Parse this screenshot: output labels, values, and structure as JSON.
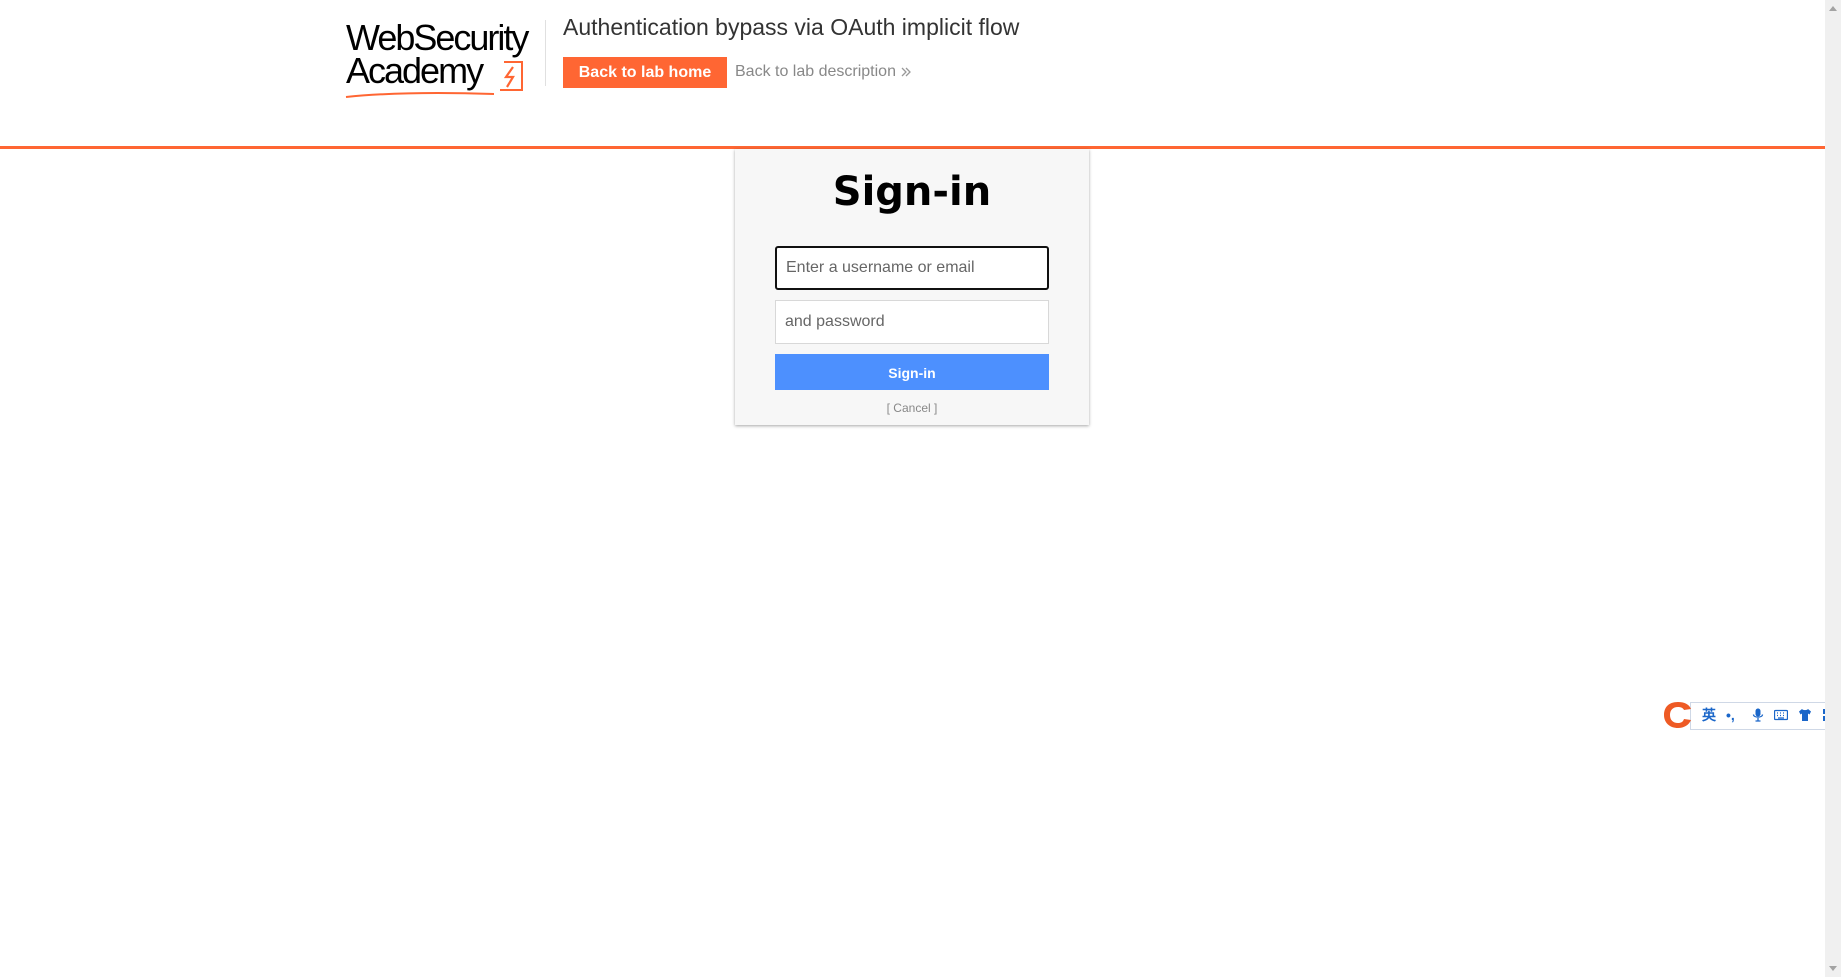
{
  "header": {
    "logo": {
      "line1": "WebSecurity",
      "line2": "Academy",
      "accent_color": "#ff6633"
    },
    "lab_title": "Authentication bypass via OAuth implicit flow",
    "back_home_label": "Back to lab home",
    "back_description_label": "Back to lab description",
    "accent_color": "#ff6633"
  },
  "login": {
    "heading": "Sign-in",
    "username_placeholder": "Enter a username or email",
    "password_placeholder": "and password",
    "username_value": "",
    "password_value": "",
    "submit_label": "Sign-in",
    "submit_color": "#4d90fe",
    "cancel_label": "[ Cancel ]"
  },
  "ime_toolbar": {
    "logo_icon": "sogou-s-icon",
    "mode_label": "英",
    "punct_label": "•,",
    "icons": [
      "microphone-icon",
      "keyboard-icon",
      "skin-shirt-icon",
      "toolbox-grid-icon"
    ],
    "color": "#1a66c9"
  }
}
